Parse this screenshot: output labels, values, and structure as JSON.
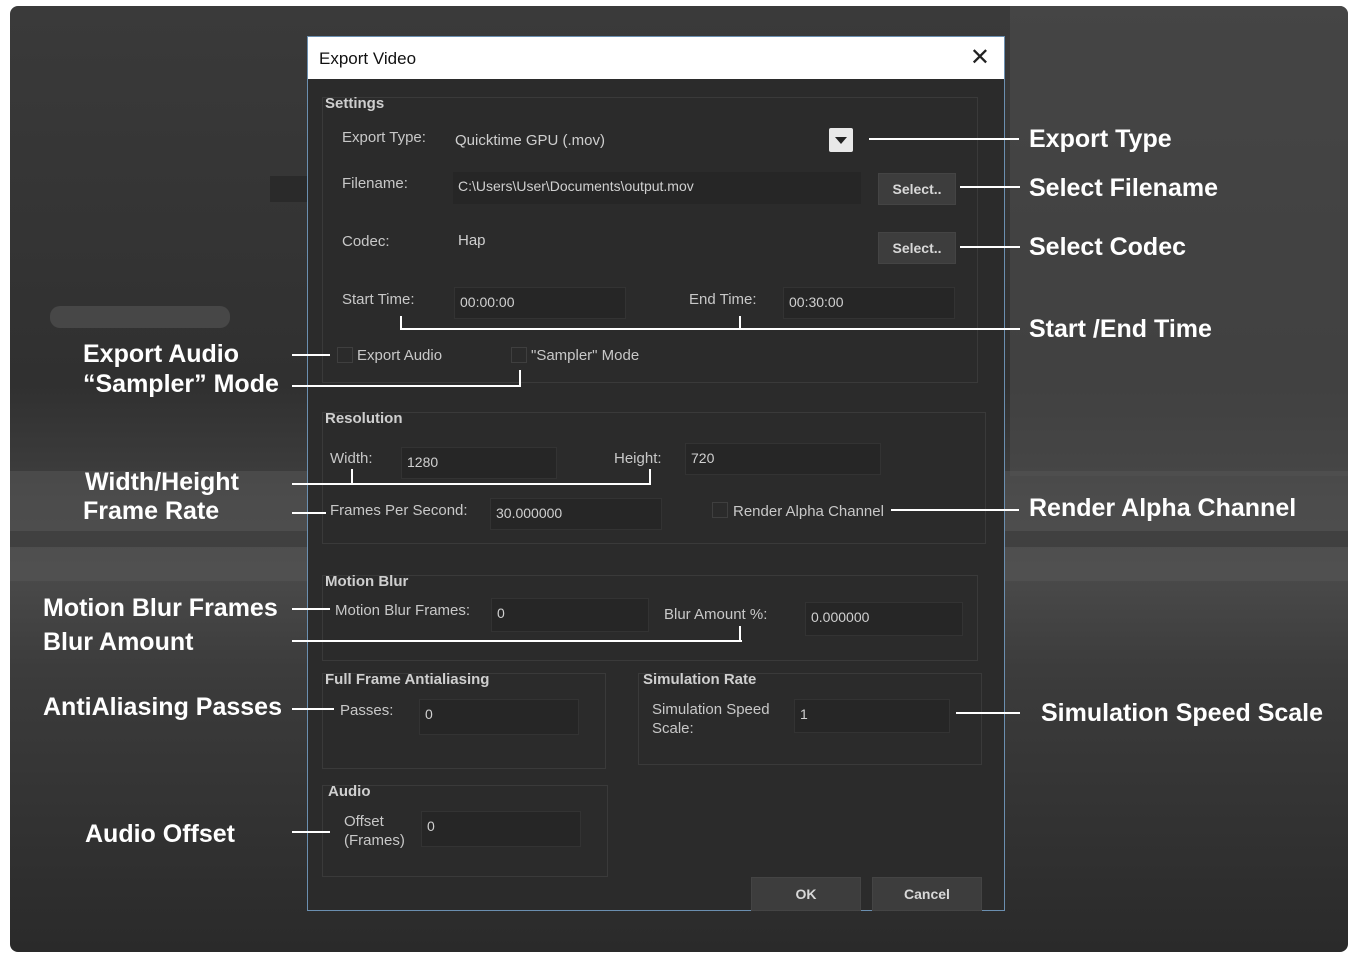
{
  "dialog": {
    "title": "Export Video",
    "settings": {
      "heading": "Settings",
      "export_type_label": "Export Type:",
      "export_type_value": "Quicktime GPU (.mov)",
      "filename_label": "Filename:",
      "filename_value": "C:\\Users\\User\\Documents\\output.mov",
      "filename_select": "Select..",
      "codec_label": "Codec:",
      "codec_value": "Hap",
      "codec_select": "Select..",
      "start_time_label": "Start Time:",
      "start_time_value": "00:00:00",
      "end_time_label": "End Time:",
      "end_time_value": "00:30:00",
      "export_audio_label": "Export Audio",
      "sampler_mode_label": "\"Sampler\" Mode"
    },
    "resolution": {
      "heading": "Resolution",
      "width_label": "Width:",
      "width_value": "1280",
      "height_label": "Height:",
      "height_value": "720",
      "fps_label": "Frames Per Second:",
      "fps_value": "30.000000",
      "alpha_label": "Render Alpha Channel"
    },
    "motion_blur": {
      "heading": "Motion Blur",
      "frames_label": "Motion Blur Frames:",
      "frames_value": "0",
      "amount_label": "Blur Amount %:",
      "amount_value": "0.000000"
    },
    "antialiasing": {
      "heading": "Full Frame Antialiasing",
      "passes_label": "Passes:",
      "passes_value": "0"
    },
    "simulation": {
      "heading": "Simulation Rate",
      "speed_label_1": "Simulation Speed",
      "speed_label_2": "Scale:",
      "speed_value": "1"
    },
    "audio": {
      "heading": "Audio",
      "offset_label_1": "Offset",
      "offset_label_2": "(Frames)",
      "offset_value": "0"
    },
    "ok": "OK",
    "cancel": "Cancel"
  },
  "annotations": {
    "export_type": "Export Type",
    "select_filename": "Select Filename",
    "select_codec": "Select Codec",
    "start_end_time": "Start /End Time",
    "export_audio": "Export Audio",
    "sampler_mode": "“Sampler” Mode",
    "width_height": "Width/Height",
    "frame_rate": "Frame Rate",
    "render_alpha": "Render Alpha Channel",
    "motion_blur_frames": "Motion Blur Frames",
    "blur_amount": "Blur Amount",
    "aa_passes": "AntiAliasing Passes",
    "sim_speed_scale": "Simulation Speed Scale",
    "audio_offset": "Audio Offset"
  },
  "colors": {
    "dialog_bg": "#2b2b2b",
    "title_bg": "#ffffff",
    "annotation": "#ffffff"
  }
}
